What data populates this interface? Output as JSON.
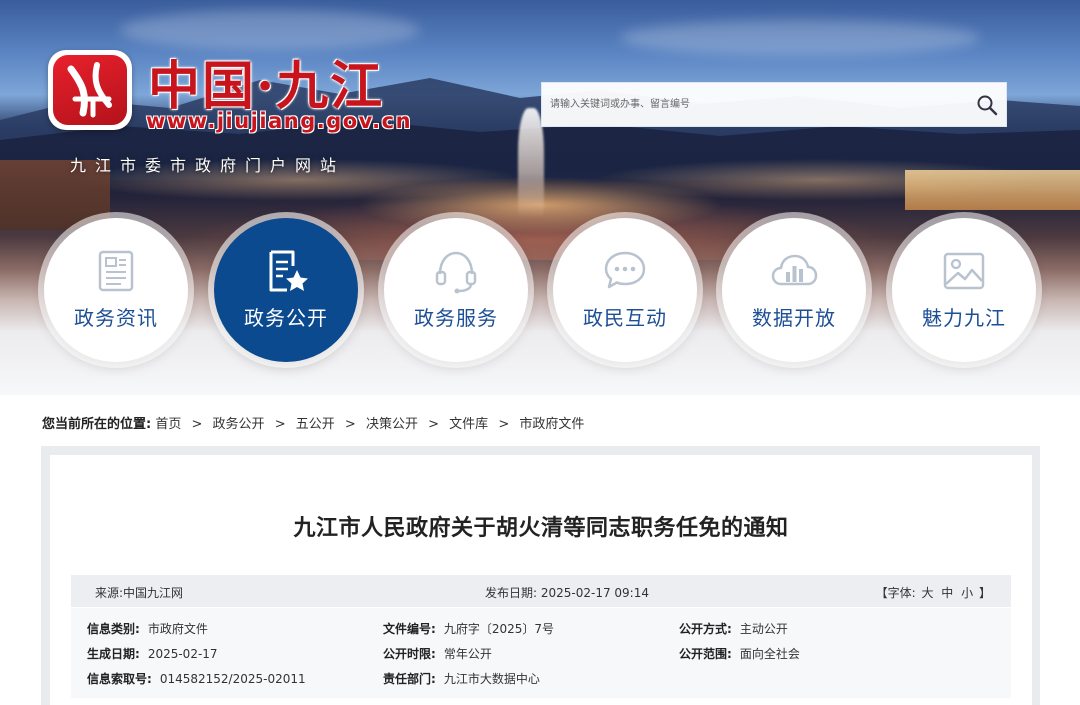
{
  "header": {
    "logo_title": "中国·九江",
    "logo_url": "www.jiujiang.gov.cn",
    "logo_subtitle": "九江市委市政府门户网站",
    "logo_badge_text": "九江",
    "search": {
      "placeholder": "请输入关键词或办事、留言编号",
      "icon": "search-icon"
    },
    "brand_color": "#c8141d"
  },
  "nav": {
    "items": [
      {
        "label": "政务资讯",
        "icon": "news-icon",
        "active": false
      },
      {
        "label": "政务公开",
        "icon": "document-star-icon",
        "active": true
      },
      {
        "label": "政务服务",
        "icon": "headset-icon",
        "active": false
      },
      {
        "label": "政民互动",
        "icon": "chat-icon",
        "active": false
      },
      {
        "label": "数据开放",
        "icon": "data-cloud-icon",
        "active": false
      },
      {
        "label": "魅力九江",
        "icon": "image-icon",
        "active": false
      }
    ],
    "active_color": "#0b4a8f",
    "text_color": "#1c4f96"
  },
  "breadcrumb": {
    "label": "您当前所在的位置:",
    "items": [
      "首页",
      "政务公开",
      "五公开",
      "决策公开",
      "文件库",
      "市政府文件"
    ],
    "separator": ">"
  },
  "article": {
    "title": "九江市人民政府关于胡火清等同志职务任免的通知",
    "source": "来源:中国九江网",
    "publish_date": "发布日期: 2025-02-17 09:14",
    "font_size": {
      "prefix": "【字体:",
      "large": "大",
      "medium": "中",
      "small": "小",
      "suffix": "】"
    },
    "info": {
      "category_key": "信息类别:",
      "category_value": "市政府文件",
      "doc_no_key": "文件编号:",
      "doc_no_value": "九府字〔2025〕7号",
      "open_method_key": "公开方式:",
      "open_method_value": "主动公开",
      "created_key": "生成日期:",
      "created_value": "2025-02-17",
      "open_period_key": "公开时限:",
      "open_period_value": "常年公开",
      "open_scope_key": "公开范围:",
      "open_scope_value": "面向全社会",
      "index_key": "信息索取号:",
      "index_value": "014582152/2025-02011",
      "dept_key": "责任部门:",
      "dept_value": "九江市大数据中心"
    }
  }
}
